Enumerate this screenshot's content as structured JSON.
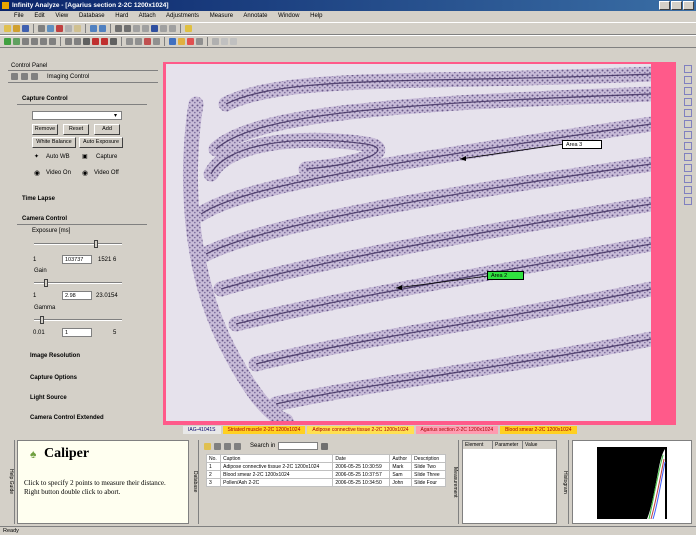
{
  "window": {
    "title": "Infinity Analyze - [Agarius section 2-2C 1200x1024]"
  },
  "menu": [
    "File",
    "Edit",
    "View",
    "Database",
    "Hard",
    "Attach",
    "Adjustments",
    "Measure",
    "Annotate",
    "Window",
    "Help"
  ],
  "left_panel": {
    "title": "Control Panel",
    "tab_label": "Imaging Control",
    "capture_control": {
      "header": "Capture Control",
      "buttons": {
        "remove": "Remove",
        "reset": "Reset",
        "add": "Add",
        "white_balance": "White Balance",
        "auto_exposure": "Auto Exposure",
        "autowb": "Auto WB",
        "capture": "Capture"
      },
      "video_on": "Video On",
      "video_off": "Video Off"
    },
    "time_lapse": "Time Lapse",
    "camera_control": {
      "header": "Camera Control",
      "exposure_label": "Exposure [ms]",
      "exposure_min": "1",
      "exposure_value": "103737",
      "exposure_max": "1521 6",
      "gain_label": "Gain",
      "gain_min": "1",
      "gain_value": "2.98",
      "gain_max": "23.0154",
      "gamma_label": "Gamma",
      "gamma_min": "0.01",
      "gamma_value": "1",
      "gamma_max": "5"
    },
    "image_resolution": "Image Resolution",
    "capture_options": "Capture Options",
    "light_source": "Light Source",
    "camera_control_extended": "Camera Control Extended"
  },
  "image": {
    "annotations": [
      {
        "text": "Area 3",
        "style": "white"
      },
      {
        "text": "Area 2",
        "style": "green"
      }
    ]
  },
  "tabs": [
    "IAG-41041S",
    "Striated muscle 2-2C 1200x1024",
    "Adipose connective tissue 2-2C 1200x1024",
    "Agarius section 2-2C 1200x1024",
    "Blood smear 2-2C 1200x1024"
  ],
  "caliper": {
    "title": "Caliper",
    "side_label": "Help Guide",
    "description": "Click to specify 2 points to measure their distance. Right button double click to abort."
  },
  "database": {
    "side_label": "Database",
    "search_label": "Search in",
    "columns": [
      "No.",
      "Caption",
      "Date",
      "Author",
      "Description"
    ],
    "rows": [
      [
        "1",
        "Adipose connective tissue 2-2C 1200x1024",
        "2006-05-25 10:30:59",
        "Mark",
        "Slide Two"
      ],
      [
        "2",
        "Blood smear 2-2C 1200x1024",
        "2006-05-25 10:37:57",
        "Sam",
        "Slide Three"
      ],
      [
        "3",
        "Pollen/Ash 2-2C",
        "2006-05-25 10:34:50",
        "John",
        "Slide Four"
      ]
    ]
  },
  "measurement": {
    "side_label": "Measurement",
    "columns": [
      "Element",
      "Parameter",
      "Value"
    ]
  },
  "histogram": {
    "side_label": "Histogram"
  },
  "status": {
    "text": "Ready"
  }
}
